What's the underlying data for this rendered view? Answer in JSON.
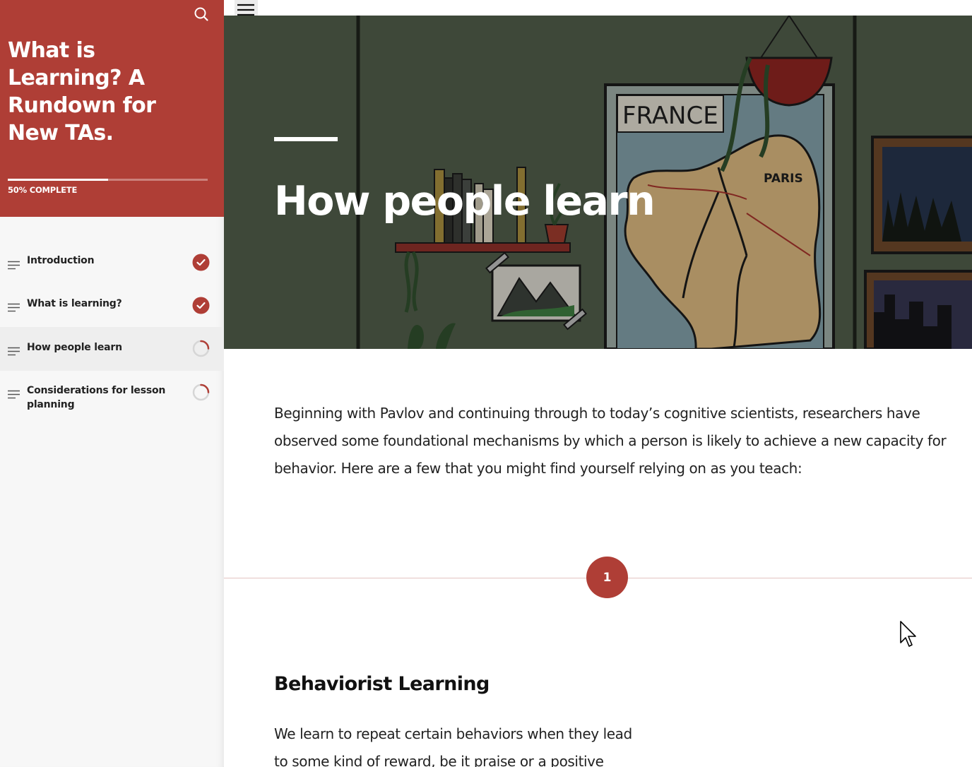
{
  "sidebar": {
    "course_title": "What is Learning? A Rundown for New TAs.",
    "progress_percent": 50,
    "progress_label": "50% COMPLETE",
    "search_icon": "search-icon",
    "lessons": [
      {
        "label": "Introduction",
        "status": "complete",
        "active": false
      },
      {
        "label": "What is learning?",
        "status": "complete",
        "active": false
      },
      {
        "label": "How people learn",
        "status": "in-progress",
        "active": true
      },
      {
        "label": "Considerations for lesson planning",
        "status": "in-progress",
        "active": false
      }
    ]
  },
  "topbar": {
    "menu_icon": "hamburger-menu-icon"
  },
  "hero": {
    "title": "How people learn"
  },
  "content": {
    "intro": "Beginning with Pavlov and continuing through to today’s cognitive scientists, researchers have observed some foundational  mechanisms by which a person is likely to achieve a new capacity for behavior. Here are a few that you might find yourself relying on as you teach:",
    "step_number": "1",
    "section_heading": "Behaviorist Learning",
    "section_body": "We learn to repeat certain behaviors when they lead to some kind of reward, be it praise or a positive"
  },
  "colors": {
    "accent": "#af3e36",
    "sidebar_bg": "#f7f7f7"
  }
}
